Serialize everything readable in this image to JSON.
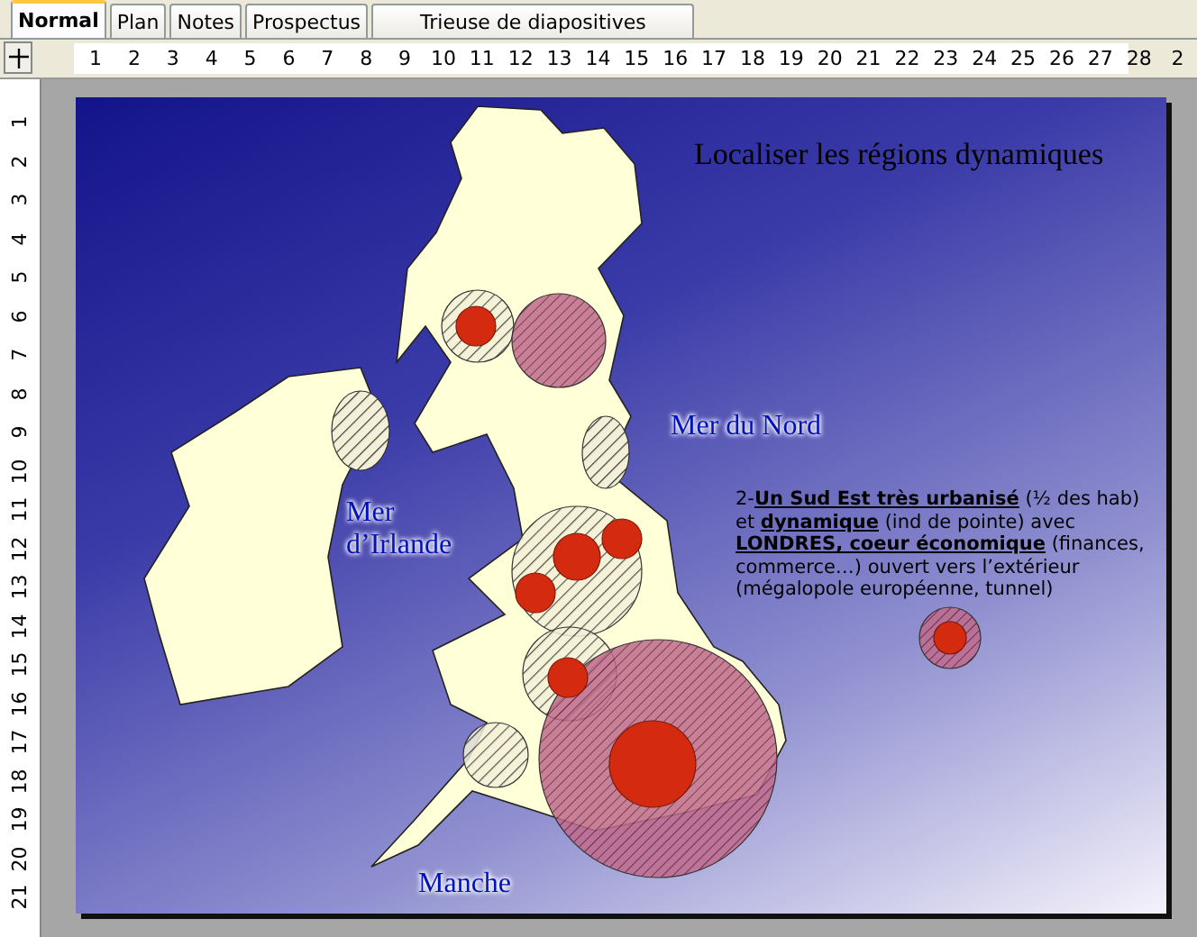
{
  "tabs": [
    {
      "label": "Normal",
      "selected": true
    },
    {
      "label": "Plan",
      "selected": false
    },
    {
      "label": "Notes",
      "selected": false
    },
    {
      "label": "Prospectus",
      "selected": false
    },
    {
      "label": "Trieuse de diapositives",
      "selected": false
    }
  ],
  "horizontal_ruler": [
    "1",
    "2",
    "3",
    "4",
    "5",
    "6",
    "7",
    "8",
    "9",
    "10",
    "11",
    "12",
    "13",
    "14",
    "15",
    "16",
    "17",
    "18",
    "19",
    "20",
    "21",
    "22",
    "23",
    "24",
    "25",
    "26",
    "27",
    "28",
    "2"
  ],
  "vertical_ruler": [
    "1",
    "2",
    "3",
    "4",
    "5",
    "6",
    "7",
    "8",
    "9",
    "10",
    "11",
    "12",
    "13",
    "14",
    "15",
    "16",
    "17",
    "18",
    "19",
    "20",
    "21"
  ],
  "slide": {
    "title": "Localiser les régions dynamiques",
    "sea_labels": [
      "Mer du Nord",
      "Mer\nd’Irlande",
      "Manche"
    ],
    "paragraph": "2-**Un Sud Est très urbanisé** (½ des hab) et **dynamique** (ind de pointe) avec **LONDRES, coeur économique** (finances, commerce…) ouvert vers l’extérieur (mégalopole européenne, tunnel)"
  }
}
